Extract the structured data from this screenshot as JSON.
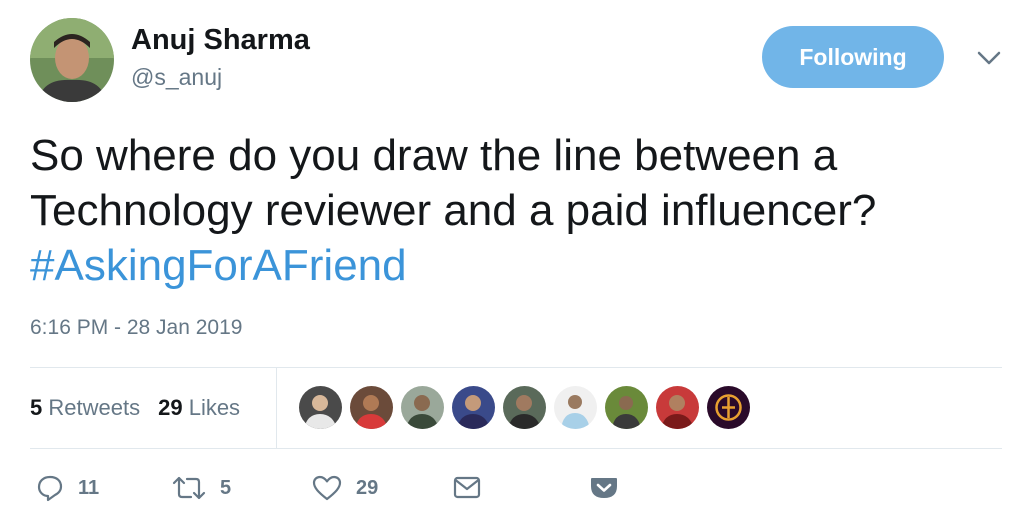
{
  "author": {
    "name": "Anuj Sharma",
    "handle": "@s_anuj",
    "avatar_icon": "user-avatar-photo"
  },
  "follow_button_label": "Following",
  "tweet": {
    "text_line1": "So where do you draw the line between a",
    "text_line2": "Technology reviewer and a paid influencer?",
    "hashtag": "#AskingForAFriend",
    "timestamp": "6:16 PM - 28 Jan 2019"
  },
  "stats": {
    "retweets_count": "5",
    "retweets_label": "Retweets",
    "likes_count": "29",
    "likes_label": "Likes"
  },
  "actions": {
    "reply_count": "11",
    "retweet_count": "5",
    "like_count": "29"
  },
  "colors": {
    "accent": "#71b5e8",
    "hashtag": "#3b94d9",
    "muted": "#657786"
  }
}
